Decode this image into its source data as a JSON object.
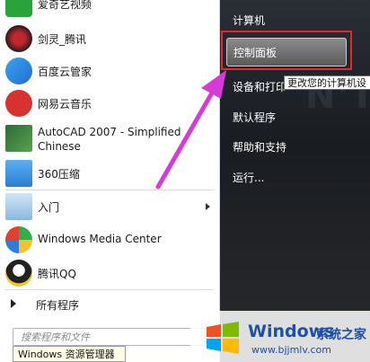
{
  "programs": [
    {
      "label": "爱奇艺视频",
      "icon": "iqiyi-icon"
    },
    {
      "label": "剑灵_腾讯",
      "icon": "blade-soul-icon"
    },
    {
      "label": "百度云管家",
      "icon": "baidu-cloud-icon"
    },
    {
      "label": "网易云音乐",
      "icon": "netease-music-icon"
    },
    {
      "label": "AutoCAD 2007 - Simplified Chinese",
      "icon": "autocad-icon"
    },
    {
      "label": "360压缩",
      "icon": "360zip-icon"
    },
    {
      "label": "入门",
      "icon": "getting-started-icon"
    },
    {
      "label": "Windows Media Center",
      "icon": "media-center-icon"
    },
    {
      "label": "腾讯QQ",
      "icon": "qq-icon"
    }
  ],
  "all_programs": "所有程序",
  "search_placeholder": "搜索程序和文件",
  "taskbar_tooltip": "Windows 资源管理器",
  "right_items": {
    "computer": "计算机",
    "control_panel": "控制面板",
    "devices": "设备和打印",
    "default_programs": "默认程序",
    "help": "帮助和支持",
    "run": "运行..."
  },
  "control_panel_tooltip": "更改您的计算机设",
  "watermark": {
    "brand": "Windows",
    "cn": "系统之家",
    "url": "www.bjjmlv.com"
  },
  "colors": {
    "highlight_border": "#e4282c",
    "annotation_arrow": "#d83ad8"
  }
}
